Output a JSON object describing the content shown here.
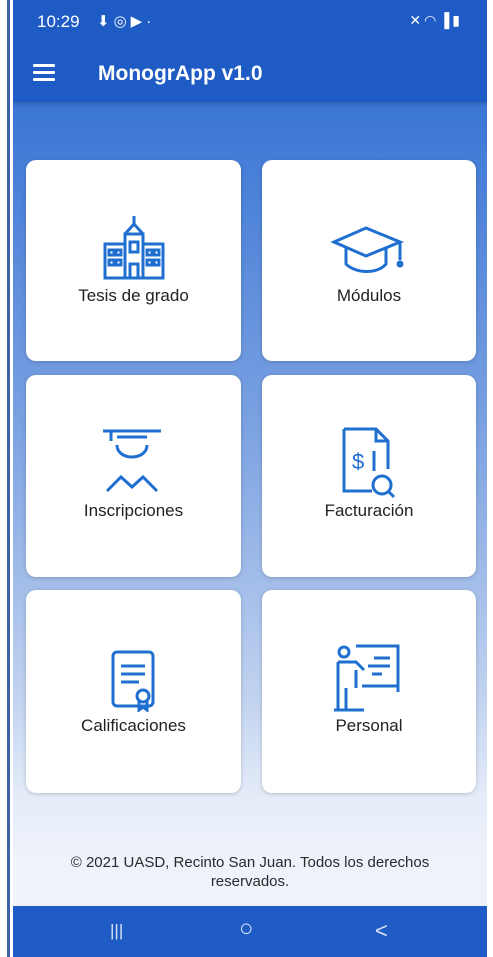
{
  "status_bar": {
    "time": "10:29",
    "left_icons": [
      "download-icon",
      "instagram-icon",
      "youtube-icon",
      "dot-icon"
    ],
    "right_icons": [
      "mute-icon",
      "wifi-icon",
      "signal-icon",
      "battery-icon"
    ]
  },
  "app_bar": {
    "title": "MonogrApp v1.0"
  },
  "cards": [
    {
      "label": "Tesis de grado",
      "icon": "building-icon"
    },
    {
      "label": "Módulos",
      "icon": "graduation-cap-icon"
    },
    {
      "label": "Inscripciones",
      "icon": "student-icon"
    },
    {
      "label": "Facturación",
      "icon": "invoice-icon"
    },
    {
      "label": "Calificaciones",
      "icon": "certificate-icon"
    },
    {
      "label": "Personal",
      "icon": "teacher-board-icon"
    }
  ],
  "footer": {
    "line1": "© 2021 UASD, Recinto San Juan. Todos los derechos",
    "line2": "reservados."
  },
  "nav_bar": {
    "recents_glyph": "|||",
    "home_glyph": "○",
    "back_glyph": "<"
  },
  "colors": {
    "primary": "#1f5bc4",
    "icon_blue": "#1f6fd1"
  }
}
